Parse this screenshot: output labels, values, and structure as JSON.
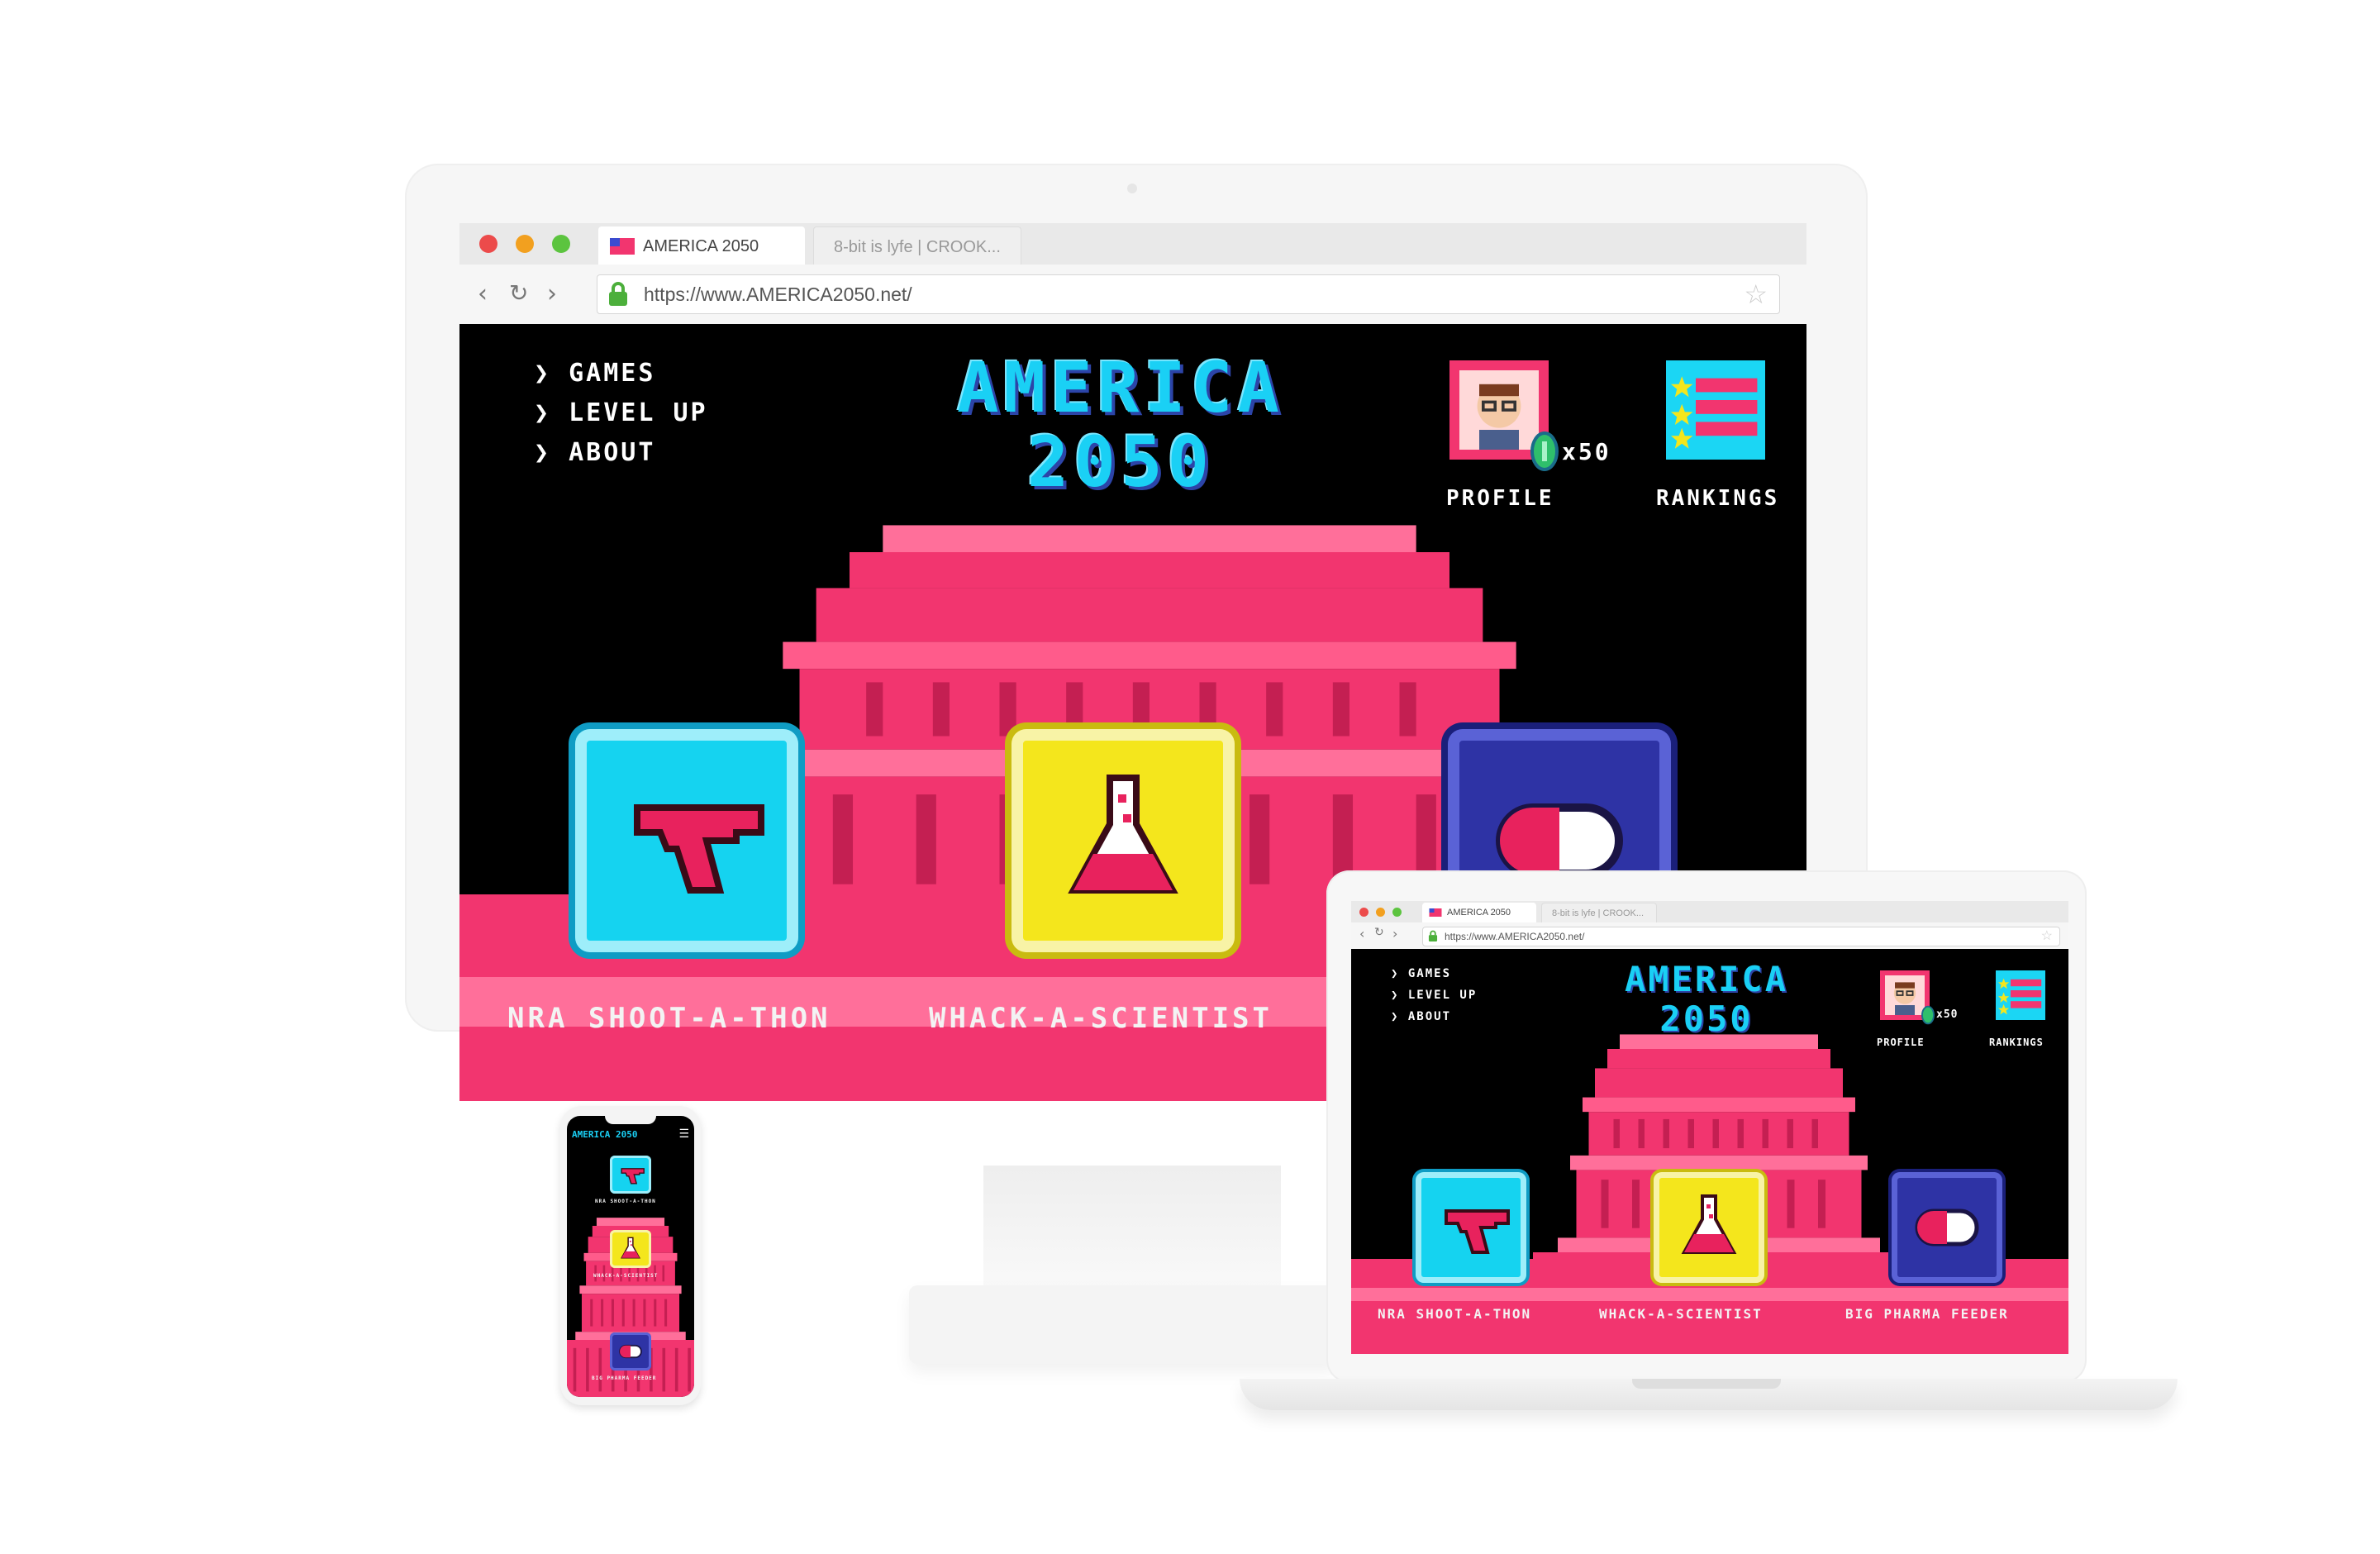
{
  "browser": {
    "tabs": [
      {
        "label": "AMERICA 2050",
        "active": true
      },
      {
        "label": "8-bit is lyfe | CROOK...",
        "active": false
      }
    ],
    "url": "https://www.AMERICA2050.net/"
  },
  "site": {
    "title_line1": "AMERICA",
    "title_line2": "2050",
    "menu": [
      {
        "label": "GAMES"
      },
      {
        "label": "LEVEL UP"
      },
      {
        "label": "ABOUT"
      }
    ],
    "profile": {
      "label": "PROFILE",
      "coins": "x50"
    },
    "rankings": {
      "label": "RANKINGS"
    },
    "games": [
      {
        "label": "NRA SHOOT-A-THON",
        "icon": "gun-icon"
      },
      {
        "label": "WHACK-A-SCIENTIST",
        "icon": "flask-icon"
      },
      {
        "label": "BIG PHARMA FEEDER",
        "icon": "pill-icon"
      }
    ],
    "mobile_title": "AMERICA 2050"
  },
  "colors": {
    "capitol_pink": "#f2356f",
    "capitol_dark": "#c41f52",
    "title_cyan": "#1ad0f5",
    "title_shadow": "#2c44a8",
    "gun_tile": "#15d3f0",
    "flask_tile": "#f4e61c",
    "pill_tile": "#2e33a5",
    "background": "#000000"
  }
}
